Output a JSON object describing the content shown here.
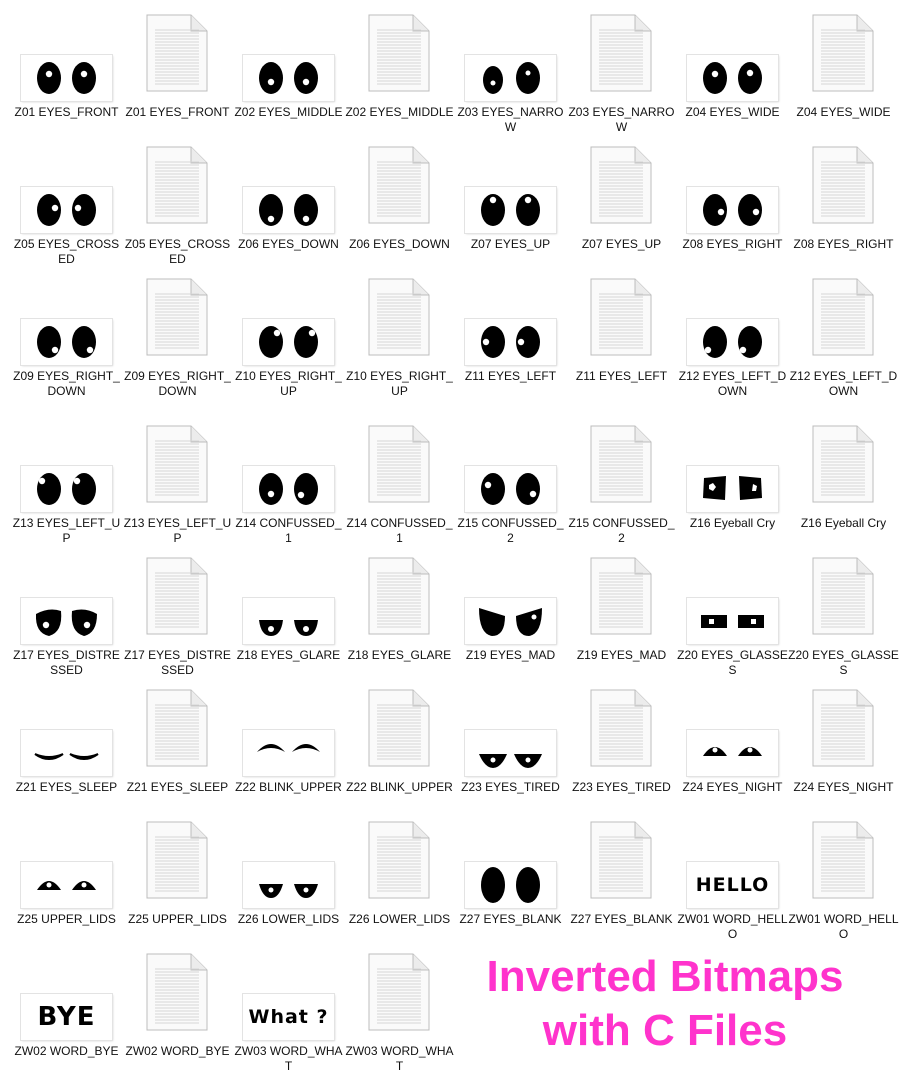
{
  "files": [
    {
      "label": "Z01 EYES_FRONT",
      "type": "bmp",
      "art": "front"
    },
    {
      "label": "Z01 EYES_FRONT",
      "type": "c"
    },
    {
      "label": "Z02 EYES_MIDDLE",
      "type": "bmp",
      "art": "middle"
    },
    {
      "label": "Z02 EYES_MIDDLE",
      "type": "c"
    },
    {
      "label": "Z03 EYES_NARROW",
      "type": "bmp",
      "art": "narrow"
    },
    {
      "label": "Z03 EYES_NARROW",
      "type": "c"
    },
    {
      "label": "Z04 EYES_WIDE",
      "type": "bmp",
      "art": "wide"
    },
    {
      "label": "Z04 EYES_WIDE",
      "type": "c"
    },
    {
      "label": "Z05 EYES_CROSSED",
      "type": "bmp",
      "art": "crossed"
    },
    {
      "label": "Z05 EYES_CROSSED",
      "type": "c"
    },
    {
      "label": "Z06 EYES_DOWN",
      "type": "bmp",
      "art": "down"
    },
    {
      "label": "Z06 EYES_DOWN",
      "type": "c"
    },
    {
      "label": "Z07 EYES_UP",
      "type": "bmp",
      "art": "up"
    },
    {
      "label": "Z07 EYES_UP",
      "type": "c"
    },
    {
      "label": "Z08 EYES_RIGHT",
      "type": "bmp",
      "art": "right"
    },
    {
      "label": "Z08 EYES_RIGHT",
      "type": "c"
    },
    {
      "label": "Z09 EYES_RIGHT_DOWN",
      "type": "bmp",
      "art": "rightdown"
    },
    {
      "label": "Z09 EYES_RIGHT_DOWN",
      "type": "c"
    },
    {
      "label": "Z10 EYES_RIGHT_UP",
      "type": "bmp",
      "art": "rightup"
    },
    {
      "label": "Z10 EYES_RIGHT_UP",
      "type": "c"
    },
    {
      "label": "Z11 EYES_LEFT",
      "type": "bmp",
      "art": "left"
    },
    {
      "label": "Z11 EYES_LEFT",
      "type": "c"
    },
    {
      "label": "Z12 EYES_LEFT_DOWN",
      "type": "bmp",
      "art": "leftdown"
    },
    {
      "label": "Z12 EYES_LEFT_DOWN",
      "type": "c"
    },
    {
      "label": "Z13 EYES_LEFT_UP",
      "type": "bmp",
      "art": "leftup"
    },
    {
      "label": "Z13 EYES_LEFT_UP",
      "type": "c"
    },
    {
      "label": "Z14 CONFUSSED_1",
      "type": "bmp",
      "art": "confused1"
    },
    {
      "label": "Z14 CONFUSSED_1",
      "type": "c"
    },
    {
      "label": "Z15 CONFUSSED_2",
      "type": "bmp",
      "art": "confused2"
    },
    {
      "label": "Z15 CONFUSSED_2",
      "type": "c"
    },
    {
      "label": "Z16 Eyeball Cry",
      "type": "bmp",
      "art": "cry"
    },
    {
      "label": "Z16 Eyeball Cry",
      "type": "c"
    },
    {
      "label": "Z17 EYES_DISTRESSED",
      "type": "bmp",
      "art": "distressed"
    },
    {
      "label": "Z17 EYES_DISTRESSED",
      "type": "c"
    },
    {
      "label": "Z18 EYES_GLARE",
      "type": "bmp",
      "art": "glare"
    },
    {
      "label": "Z18 EYES_GLARE",
      "type": "c"
    },
    {
      "label": "Z19 EYES_MAD",
      "type": "bmp",
      "art": "mad"
    },
    {
      "label": "Z19 EYES_MAD",
      "type": "c"
    },
    {
      "label": "Z20 EYES_GLASSES",
      "type": "bmp",
      "art": "glasses"
    },
    {
      "label": "Z20 EYES_GLASSES",
      "type": "c"
    },
    {
      "label": "Z21 EYES_SLEEP",
      "type": "bmp",
      "art": "sleep"
    },
    {
      "label": "Z21 EYES_SLEEP",
      "type": "c"
    },
    {
      "label": "Z22 BLINK_UPPER",
      "type": "bmp",
      "art": "blink"
    },
    {
      "label": "Z22 BLINK_UPPER",
      "type": "c"
    },
    {
      "label": "Z23 EYES_TIRED",
      "type": "bmp",
      "art": "tired"
    },
    {
      "label": "Z23 EYES_TIRED",
      "type": "c"
    },
    {
      "label": "Z24 EYES_NIGHT",
      "type": "bmp",
      "art": "night"
    },
    {
      "label": "Z24 EYES_NIGHT",
      "type": "c"
    },
    {
      "label": "Z25 UPPER_LIDS",
      "type": "bmp",
      "art": "upperlids"
    },
    {
      "label": "Z25 UPPER_LIDS",
      "type": "c"
    },
    {
      "label": "Z26 LOWER_LIDS",
      "type": "bmp",
      "art": "lowerlids"
    },
    {
      "label": "Z26 LOWER_LIDS",
      "type": "c"
    },
    {
      "label": "Z27 EYES_BLANK",
      "type": "bmp",
      "art": "blank"
    },
    {
      "label": "Z27 EYES_BLANK",
      "type": "c"
    },
    {
      "label": "ZW01 WORD_HELLO",
      "type": "bmp",
      "art": "word",
      "word": "HELLO"
    },
    {
      "label": "ZW01 WORD_HELLO",
      "type": "c"
    },
    {
      "label": "ZW02 WORD_BYE",
      "type": "bmp",
      "art": "word",
      "word": "BYE"
    },
    {
      "label": "ZW02 WORD_BYE",
      "type": "c"
    },
    {
      "label": "ZW03 WORD_WHAT",
      "type": "bmp",
      "art": "word",
      "word": "What ?"
    },
    {
      "label": "ZW03 WORD_WHAT",
      "type": "c"
    }
  ],
  "caption": {
    "line1": "Inverted Bitmaps",
    "line2": "with C Files"
  },
  "colors": {
    "caption": "#ff33cc",
    "ink": "#000000"
  }
}
